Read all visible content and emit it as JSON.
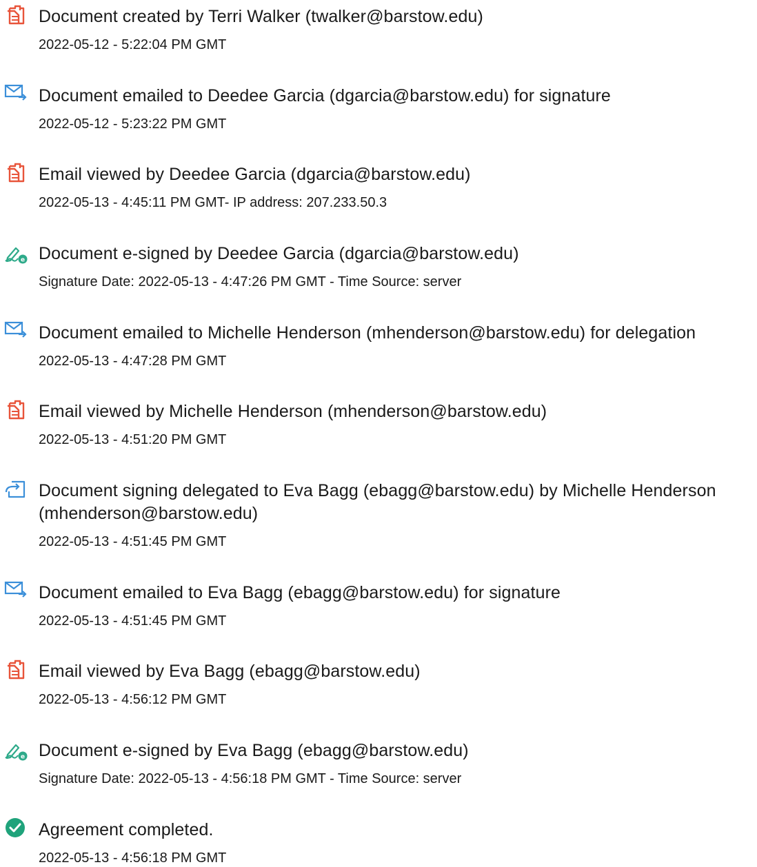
{
  "colors": {
    "doc_icon": "#e8543a",
    "email_icon": "#3b8fd9",
    "sign_icon": "#2eaa8a",
    "complete_icon": "#1fa37b",
    "text": "#1a1a1a"
  },
  "events": [
    {
      "icon": "document-icon",
      "title": "Document created by Terri Walker (twalker@barstow.edu)",
      "detail": "2022-05-12 - 5:22:04 PM GMT"
    },
    {
      "icon": "email-sent-icon",
      "title": "Document emailed to Deedee Garcia (dgarcia@barstow.edu) for signature",
      "detail": "2022-05-12 - 5:23:22 PM GMT"
    },
    {
      "icon": "document-icon",
      "title": "Email viewed by Deedee Garcia (dgarcia@barstow.edu)",
      "detail": "2022-05-13 - 4:45:11 PM GMT- IP address: 207.233.50.3"
    },
    {
      "icon": "esign-icon",
      "title": "Document e-signed by Deedee Garcia (dgarcia@barstow.edu)",
      "detail": "Signature Date: 2022-05-13 - 4:47:26 PM GMT - Time Source: server"
    },
    {
      "icon": "email-sent-icon",
      "title": "Document emailed to Michelle Henderson (mhenderson@barstow.edu) for delegation",
      "detail": "2022-05-13 - 4:47:28 PM GMT"
    },
    {
      "icon": "document-icon",
      "title": "Email viewed by Michelle Henderson (mhenderson@barstow.edu)",
      "detail": "2022-05-13 - 4:51:20 PM GMT"
    },
    {
      "icon": "delegate-icon",
      "title": "Document signing delegated to Eva Bagg (ebagg@barstow.edu) by Michelle Henderson (mhenderson@barstow.edu)",
      "detail": "2022-05-13 - 4:51:45 PM GMT"
    },
    {
      "icon": "email-sent-icon",
      "title": "Document emailed to Eva Bagg (ebagg@barstow.edu) for signature",
      "detail": "2022-05-13 - 4:51:45 PM GMT"
    },
    {
      "icon": "document-icon",
      "title": "Email viewed by Eva Bagg (ebagg@barstow.edu)",
      "detail": "2022-05-13 - 4:56:12 PM GMT"
    },
    {
      "icon": "esign-icon",
      "title": "Document e-signed by Eva Bagg (ebagg@barstow.edu)",
      "detail": "Signature Date: 2022-05-13 - 4:56:18 PM GMT - Time Source: server"
    },
    {
      "icon": "checkmark-circle-icon",
      "title": "Agreement completed.",
      "detail": "2022-05-13 - 4:56:18 PM GMT"
    }
  ]
}
